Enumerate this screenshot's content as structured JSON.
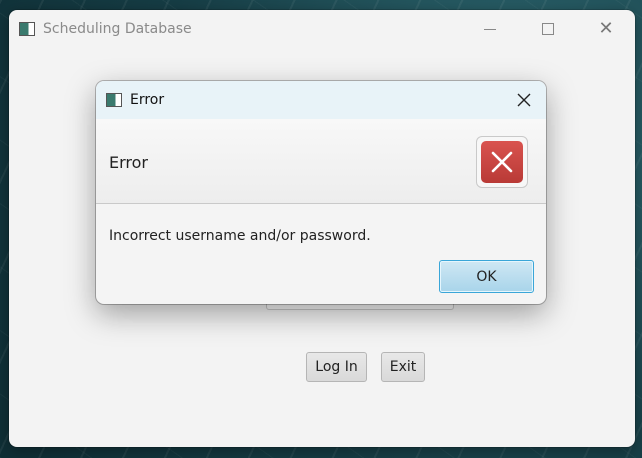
{
  "main_window": {
    "title": "Scheduling Database",
    "buttons": {
      "login": "Log In",
      "exit": "Exit"
    }
  },
  "dialog": {
    "title": "Error",
    "header_text": "Error",
    "message": "Incorrect username and/or password.",
    "ok_label": "OK"
  },
  "icons": {
    "app": "app-icon",
    "error": "error-x-icon",
    "error_color": "#c9423e"
  }
}
